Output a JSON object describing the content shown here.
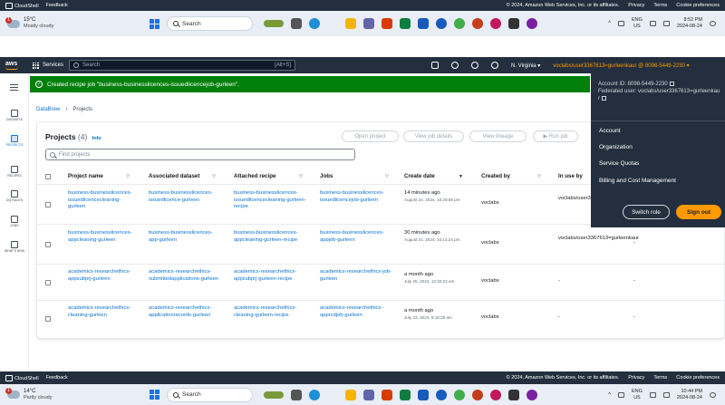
{
  "top_strip": {
    "cloudshell": "CloudShell",
    "feedback": "Feedback",
    "copyright": "© 2024, Amazon Web Services, Inc. or its affiliates.",
    "privacy": "Privacy",
    "terms": "Terms",
    "cookies": "Cookie preferences"
  },
  "taskbar_top": {
    "badge": "1",
    "temp": "15°C",
    "condition": "Mostly cloudy",
    "search": "Search",
    "lang": "ENG",
    "region": "US",
    "time": "8:52 PM",
    "date": "2024-08-24"
  },
  "aws_nav": {
    "services": "Services",
    "search_placeholder": "Search",
    "shortcut": "[Alt+S]",
    "region": "N. Virginia ▾",
    "account": "voclabs/user3367613=gurleenkaur @ 8098-5449-2230 ▾"
  },
  "rail": [
    "DATASETS",
    "PROJECTS",
    "RECIPES",
    "DQ RULES",
    "JOBS",
    "WHAT'S NEW"
  ],
  "flash": {
    "message": "Created recipe job \"business-businesslicences-issuedlicencejob-gurleen\"."
  },
  "breadcrumb": {
    "root": "DataBrew",
    "current": "Projects"
  },
  "panel": {
    "title": "Projects",
    "count": "(4)",
    "info": "Info",
    "buttons": {
      "open": "Open project",
      "job_details": "View job details",
      "lineage": "View lineage",
      "run": "▶ Run job"
    },
    "find_placeholder": "Find projects"
  },
  "columns": [
    "Project name",
    "Associated dataset",
    "Attached recipe",
    "Jobs",
    "Create date",
    "Created by",
    "In use by"
  ],
  "rows": [
    {
      "project": "business-businesslicences-issuedlicencecleaning-gurleen",
      "dataset": "business-businesslicences-issuedlicence-gurleen",
      "recipe": "business-businesslicences-issuedlicencecleaning-gurleen-recipe",
      "jobs": "business-businesslicences-issuedlicencejob-gurleen",
      "date": "14 minutes ago",
      "date_sub": "August 24, 2024, 10:29:59 pm",
      "created_by": "voclabs",
      "in_use": "voclabs/user3367613=gurleenkaur",
      "extra": ""
    },
    {
      "project": "business-businesslicences-appcleaning-gurleen",
      "dataset": "business-businesslicences-app-gurleen",
      "recipe": "business-businesslicences-appcleaning-gurleen-recipe",
      "jobs": "business-businesslicences-appjob-gurleen",
      "date": "30 minutes ago",
      "date_sub": "August 24, 2024, 10:14:24 pm",
      "created_by": "voclabs",
      "in_use": "voclabs/user3367613=gurleenkaur",
      "extra": "-"
    },
    {
      "project": "academics-researchethics-appsubprj-gurleen",
      "dataset": "academics-researchethics-submittedapplications-gurleen",
      "recipe": "academics-researchethics-appsubprj-gurleen-recipe",
      "jobs": "academics-researchethics-job-gurleen",
      "date": "a month ago",
      "date_sub": "July 25, 2024, 12:32:22 am",
      "created_by": "voclabs",
      "in_use": "-",
      "extra": "-"
    },
    {
      "project": "academics-researchethics-cleaning-gurleen",
      "dataset": "academics-researchethics-applicationrecords-gurleen",
      "recipe": "academics-researchethics-cleaning-gurleen-recipe",
      "jobs": "academics-researchethics-apprcdjob-gurleen",
      "date": "a month ago",
      "date_sub": "July 23, 2024, 8:16:25 am",
      "created_by": "voclabs",
      "in_use": "-",
      "extra": "-"
    }
  ],
  "account_menu": {
    "account_id": "Account ID: 8098-5449-2230",
    "federated": "Federated user: voclabs/user3367613=gurleenkaur",
    "items": [
      "Account",
      "Organization",
      "Service Quotas",
      "Billing and Cost Management"
    ],
    "switch_role": "Switch role",
    "sign_out": "Sign out"
  },
  "taskbar_bottom": {
    "badge": "1",
    "temp": "14°C",
    "condition": "Partly cloudy",
    "search": "Search",
    "lang": "ENG",
    "region": "US",
    "time": "10:44 PM",
    "date": "2024-08-24"
  },
  "colors": {
    "aws_dark": "#232f3e",
    "success": "#037f0c",
    "link": "#0972d3",
    "orange": "#ff9900"
  }
}
